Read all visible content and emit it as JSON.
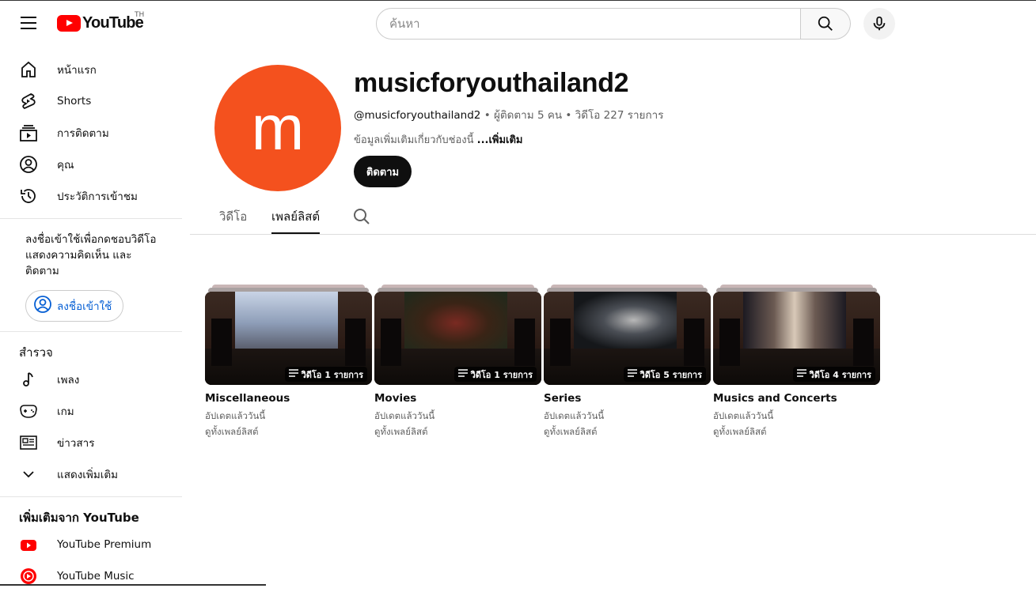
{
  "header": {
    "logo_text": "YouTube",
    "country_code": "TH",
    "search_placeholder": "ค้นหา"
  },
  "sidebar": {
    "primary": [
      {
        "label": "หน้าแรก",
        "icon": "home-icon"
      },
      {
        "label": "Shorts",
        "icon": "shorts-icon"
      },
      {
        "label": "การติดตาม",
        "icon": "subscriptions-icon"
      },
      {
        "label": "คุณ",
        "icon": "you-icon"
      },
      {
        "label": "ประวัติการเข้าชม",
        "icon": "history-icon"
      }
    ],
    "signin_prompt_line1": "ลงชื่อเข้าใช้เพื่อกดชอบวิดีโอ",
    "signin_prompt_line2": "แสดงความคิดเห็น และติดตาม",
    "signin_button": "ลงชื่อเข้าใช้",
    "explore_title": "สำรวจ",
    "explore": [
      {
        "label": "เพลง",
        "icon": "music-icon"
      },
      {
        "label": "เกม",
        "icon": "gaming-icon"
      },
      {
        "label": "ข่าวสาร",
        "icon": "news-icon"
      },
      {
        "label": "แสดงเพิ่มเติม",
        "icon": "chevron-down-icon"
      }
    ],
    "more_title": "เพิ่มเติมจาก YouTube",
    "more": [
      {
        "label": "YouTube Premium",
        "icon": "youtube-premium-icon"
      },
      {
        "label": "YouTube Music",
        "icon": "youtube-music-icon"
      }
    ]
  },
  "channel": {
    "avatar_letter": "m",
    "name": "musicforyouthailand2",
    "handle": "@musicforyouthailand2",
    "subscribers": "ผู้ติดตาม 5 คน",
    "videos": "วิดีโอ 227 รายการ",
    "description": "ข้อมูลเพิ่มเติมเกี่ยวกับช่องนี้",
    "more_label": "...เพิ่มเติม",
    "subscribe_label": "ติดตาม"
  },
  "tabs": [
    {
      "label": "วิดีโอ",
      "active": false
    },
    {
      "label": "เพลย์ลิสต์",
      "active": true
    }
  ],
  "playlists": [
    {
      "title": "Miscellaneous",
      "count": "วิดีโอ 1 รายการ",
      "updated": "อัปเดตแล้ววันนี้",
      "view_all": "ดูทั้งเพลย์ลิสต์"
    },
    {
      "title": "Movies",
      "count": "วิดีโอ 1 รายการ",
      "updated": "อัปเดตแล้ววันนี้",
      "view_all": "ดูทั้งเพลย์ลิสต์"
    },
    {
      "title": "Series",
      "count": "วิดีโอ 5 รายการ",
      "updated": "อัปเดตแล้ววันนี้",
      "view_all": "ดูทั้งเพลย์ลิสต์"
    },
    {
      "title": "Musics and Concerts",
      "count": "วิดีโอ 4 รายการ",
      "updated": "อัปเดตแล้ววันนี้",
      "view_all": "ดูทั้งเพลย์ลิสต์"
    }
  ],
  "colors": {
    "brand_red": "#ff0000",
    "avatar_bg": "#f4511e",
    "link_blue": "#065fd4"
  }
}
